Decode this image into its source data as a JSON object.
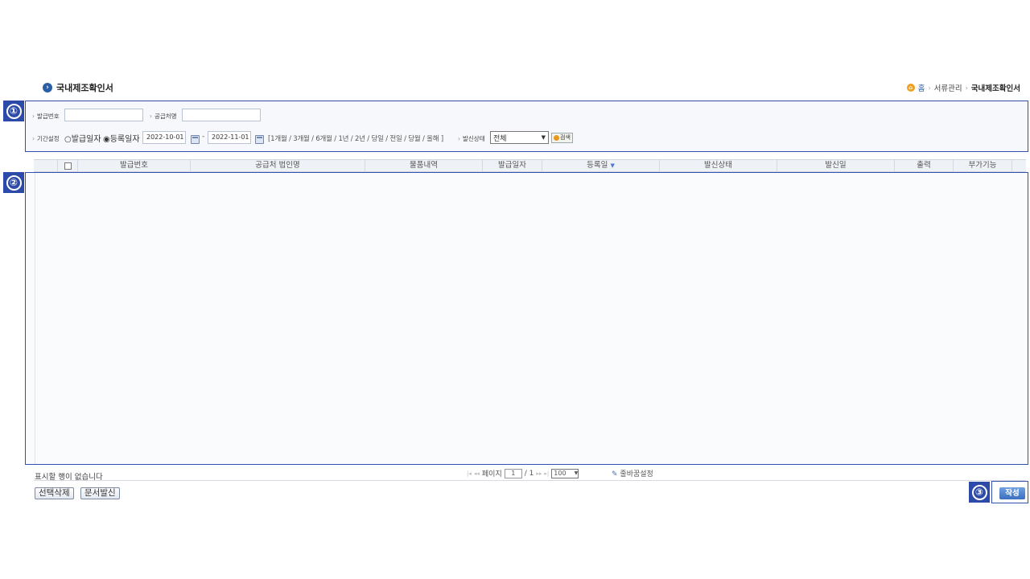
{
  "page": {
    "title": "국내제조확인서"
  },
  "breadcrumb": {
    "home": "홈",
    "level1": "서류관리",
    "current": "국내제조확인서"
  },
  "markers": [
    "①",
    "②",
    "③"
  ],
  "search": {
    "issue_no_label": "발급번호",
    "issue_no_value": "",
    "supplier_label": "공급처명",
    "supplier_value": "",
    "period_label": "기간설정",
    "radio_issue_date": "○발급일자",
    "radio_reg_date": "◉등록일자",
    "date_from": "2022-10-01",
    "date_to": "2022-11-01",
    "date_sep": "-",
    "period_shortcuts": "[1개월 / 3개월 / 6개월 / 1년 / 2년 / 당일 / 전일 / 당월 / 올해 ]",
    "send_status_label": "발신상태",
    "send_status_value": "전체",
    "search_button": "검색"
  },
  "grid": {
    "columns": [
      "발급번호",
      "공급처 법인명",
      "물품내역",
      "발급일자",
      "등록일",
      "발신상태",
      "발신일",
      "출력",
      "부가기능"
    ],
    "rows": []
  },
  "footer": {
    "empty_message": "표시할 행이 없습니다",
    "page_label": "페이지",
    "page_current": "1",
    "page_total": "/ 1",
    "per_page": "100",
    "column_setting": "줄바꿈설정"
  },
  "actions": {
    "delete_selected": "선택삭제",
    "send_document": "문서발신",
    "write": "작성"
  },
  "colors": {
    "marker": "#2c4aa8",
    "accent": "#2a5fa8"
  }
}
